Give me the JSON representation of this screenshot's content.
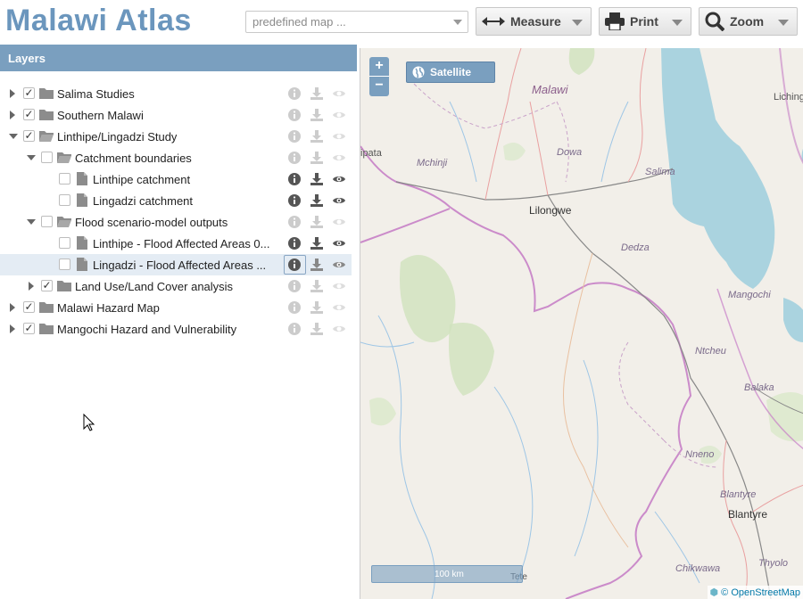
{
  "header": {
    "title": "Malawi Atlas",
    "map_select_placeholder": "predefined map ...",
    "measure_label": "Measure",
    "print_label": "Print",
    "zoom_label": "Zoom"
  },
  "layers": {
    "header": "Layers",
    "items": [
      {
        "label": "Salima Studies"
      },
      {
        "label": "Southern Malawi"
      },
      {
        "label": "Linthipe/Lingadzi Study"
      },
      {
        "label": "Catchment boundaries"
      },
      {
        "label": "Linthipe catchment"
      },
      {
        "label": "Lingadzi catchment"
      },
      {
        "label": "Flood scenario-model outputs"
      },
      {
        "label": "Linthipe - Flood Affected Areas 0..."
      },
      {
        "label": "Lingadzi - Flood Affected Areas ..."
      },
      {
        "label": "Land Use/Land Cover analysis"
      },
      {
        "label": "Malawi Hazard Map"
      },
      {
        "label": "Mangochi Hazard and Vulnerability"
      }
    ]
  },
  "map": {
    "zoom_in": "+",
    "zoom_out": "−",
    "satellite_label": "Satellite",
    "scale_label": "100 km",
    "attribution": "© OpenStreetMap",
    "labels": {
      "malawi": "Malawi",
      "lichinga": "Lichinga",
      "ipata": "ipata",
      "mchinji": "Mchinji",
      "dowa": "Dowa",
      "salima": "Salima",
      "lilongwe": "Lilongwe",
      "dedza": "Dedza",
      "mangochi": "Mangochi",
      "ntcheu": "Ntcheu",
      "balaka": "Balaka",
      "nneno": "Nneno",
      "blantyre_small": "Blantyre",
      "blantyre": "Blantyre",
      "chikwawa": "Chikwawa",
      "thyolo": "Thyolo",
      "tete": "Tete"
    }
  },
  "colors": {
    "accent": "#7a9fbf",
    "title": "#6b96bd",
    "lake": "#aad3df",
    "border": "#c77fc7"
  }
}
